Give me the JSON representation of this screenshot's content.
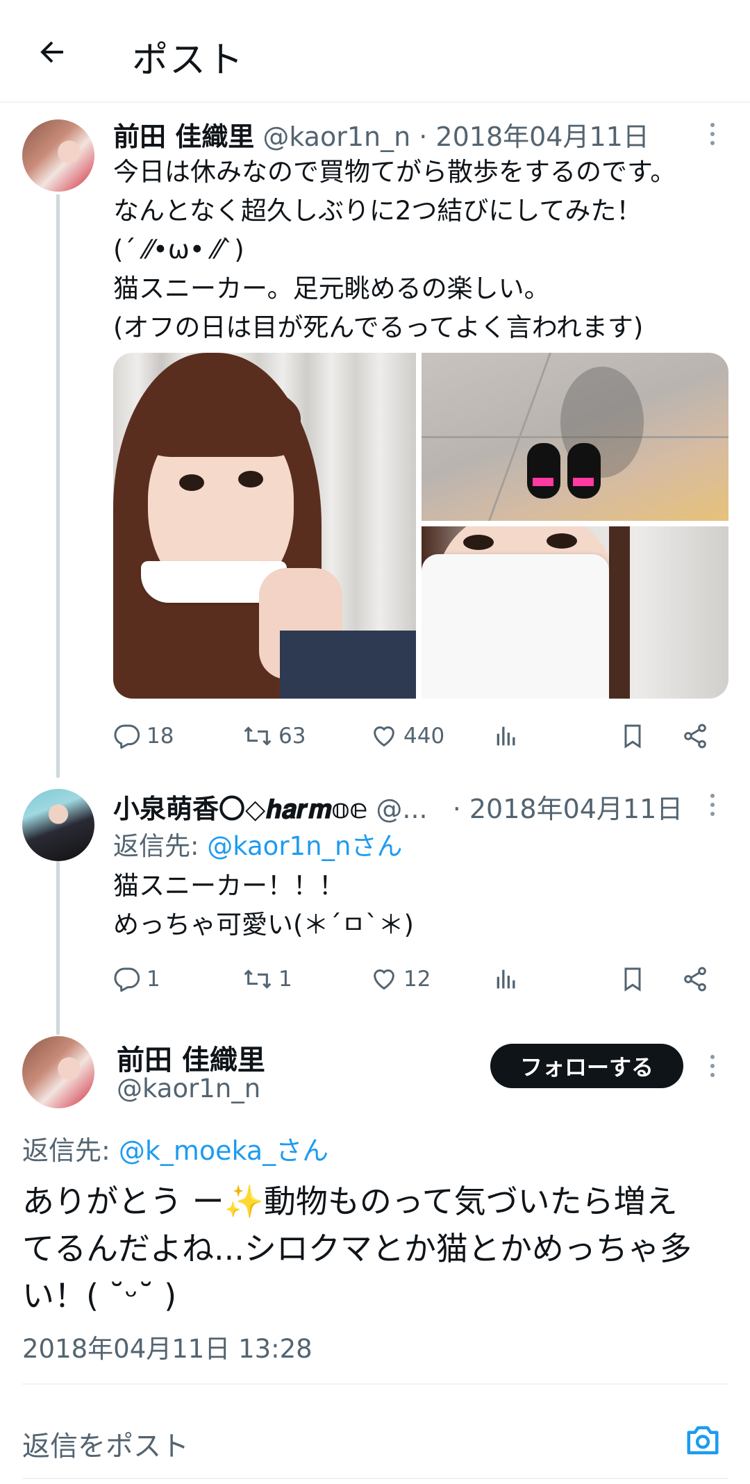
{
  "header": {
    "title": "ポスト"
  },
  "tweets": [
    {
      "name": "前田 佳織里",
      "handle": "@kaor1n_n",
      "date": "· 2018年04月11日",
      "text": "今日は休みなので買物てがら散歩をするのです。\nなんとなく超久しぶりに2つ結びにしてみた！\n(´ ⁄⁄•ω• ⁄⁄`)\n猫スニーカー。足元眺めるの楽しい。\n(オフの日は目が死んでるってよく言われます)",
      "replies": "18",
      "retweets": "63",
      "likes": "440"
    },
    {
      "name": "小泉萌香〇◇𝒉𝒂𝒓𝒎𝕠𝕖",
      "handle": "@...",
      "date": "· 2018年04月11日",
      "reply_to_label": "返信先:",
      "reply_to_user": "@kaor1n_nさん",
      "text": "猫スニーカー！！！\nめっちゃ可愛い(＊´ㅁ`＊)",
      "replies": "1",
      "retweets": "1",
      "likes": "12"
    }
  ],
  "main": {
    "name": "前田 佳織里",
    "handle": "@kaor1n_n",
    "follow_label": "フォローする",
    "reply_to_label": "返信先:",
    "reply_to_user": "@k_moeka_さん",
    "text_part1": "ありがとう ー",
    "sparkle": "✨",
    "text_part2": "動物ものって気づいたら増え\nてるんだよね...シロクマとか猫とかめっちゃ多\nい！( ˘ᵕ˘ )",
    "timestamp": "2018年04月11日 13:28"
  },
  "reply_bar": {
    "placeholder": "返信をポスト"
  },
  "colors": {
    "accent": "#1d9bf0",
    "text": "#0f1419",
    "muted": "#536471",
    "line": "#cfd9de"
  },
  "icons": [
    "back-arrow-icon",
    "more-icon",
    "reply-icon",
    "retweet-icon",
    "like-icon",
    "views-icon",
    "bookmark-icon",
    "share-icon",
    "camera-icon"
  ]
}
